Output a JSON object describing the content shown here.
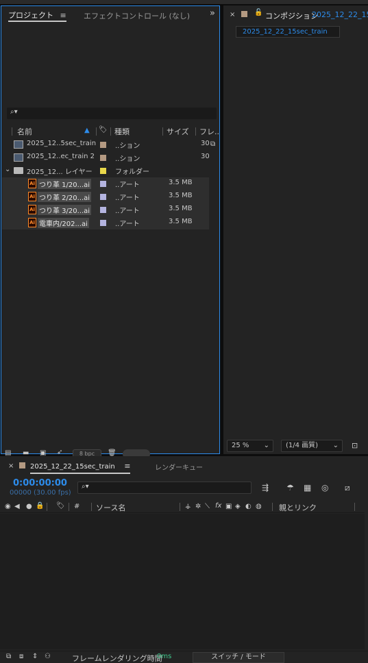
{
  "project_panel": {
    "tab_label": "プロジェクト",
    "effect_tab_label": "エフェクトコントロール (なし)",
    "columns": {
      "name": "名前",
      "type": "種類",
      "size": "サイズ",
      "frame": "フレ.."
    },
    "rows": [
      {
        "name": "2025_12..5sec_train",
        "type": "..ション",
        "size": "",
        "frame": "30",
        "label_color": "#b49a82",
        "icon": "composition-icon",
        "highlight": false
      },
      {
        "name": "2025_12..ec_train 2",
        "type": "..ション",
        "size": "",
        "frame": "30",
        "label_color": "#b49a82",
        "icon": "composition-icon",
        "highlight": false
      },
      {
        "name": "2025_12... レイヤー",
        "type": "フォルダー",
        "size": "",
        "frame": "",
        "label_color": "#e9d84a",
        "icon": "folder-icon",
        "highlight": false
      },
      {
        "name": "つり革 1/20...ai",
        "type": "..アート",
        "size": "3.5 MB",
        "frame": "",
        "label_color": "#b4b4e0",
        "icon": "illustrator-file-icon",
        "highlight": true
      },
      {
        "name": "つり革 2/20...ai",
        "type": "..アート",
        "size": "3.5 MB",
        "frame": "",
        "label_color": "#b4b4e0",
        "icon": "illustrator-file-icon",
        "highlight": true
      },
      {
        "name": "つり革 3/20...ai",
        "type": "..アート",
        "size": "3.5 MB",
        "frame": "",
        "label_color": "#b4b4e0",
        "icon": "illustrator-file-icon",
        "highlight": true
      },
      {
        "name": "電車内/202...ai",
        "type": "..アート",
        "size": "3.5 MB",
        "frame": "",
        "label_color": "#b4b4e0",
        "icon": "illustrator-file-icon",
        "highlight": true
      }
    ],
    "bpc_label": "8 bpc"
  },
  "comp_panel": {
    "tab_label": "コンポジション",
    "comp_name_truncated": "2025_12_22_15s",
    "comp_tab": "2025_12_22_15sec_train",
    "zoom": "25 %",
    "resolution": "(1/4 画質)"
  },
  "timeline": {
    "tab_label": "2025_12_22_15sec_train",
    "render_queue_label": "レンダーキュー",
    "timecode": "0:00:00:00",
    "frame_info": "00000 (30.00 fps)",
    "col_hash": "#",
    "col_source": "ソース名",
    "col_fx": "fx",
    "col_parent": "親とリンク",
    "render_time_label": "フレームレンダリング時間",
    "render_time_value": "0ms",
    "mode_label": "スイッチ / モード"
  },
  "colors": {
    "accent": "#2d8ceb",
    "panel_bg": "#232323"
  }
}
